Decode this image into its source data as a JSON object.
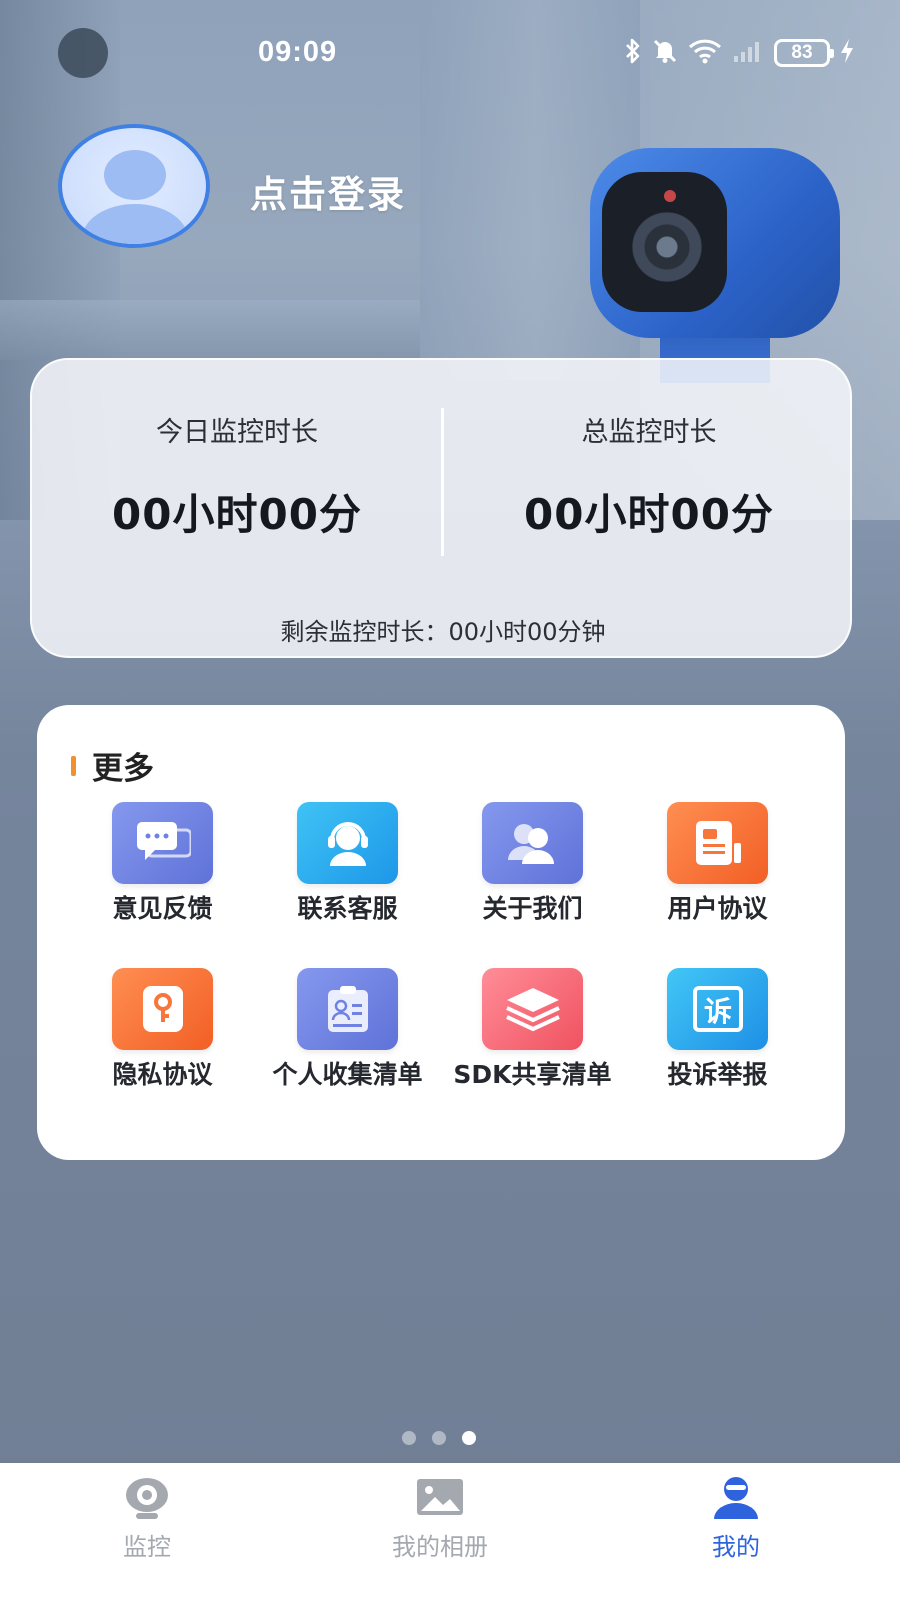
{
  "status_bar": {
    "time": "09:09",
    "battery": "83",
    "icons": [
      "bluetooth-icon",
      "mute-icon",
      "wifi-icon",
      "signal-icon",
      "battery-icon",
      "charging-icon"
    ]
  },
  "profile": {
    "login_text": "点击登录"
  },
  "stats": {
    "today_label": "今日监控时长",
    "today_value": "00小时00分",
    "total_label": "总监控时长",
    "total_value": "00小时00分",
    "remaining": "剩余监控时长：00小时00分钟"
  },
  "more": {
    "title": "更多",
    "items": [
      {
        "label": "意见反馈",
        "icon": "feedback-icon",
        "color": "#6f82e4"
      },
      {
        "label": "联系客服",
        "icon": "customer-service-icon",
        "color": "#2aa9ef"
      },
      {
        "label": "关于我们",
        "icon": "about-us-icon",
        "color": "#6f82e4"
      },
      {
        "label": "用户协议",
        "icon": "user-agreement-icon",
        "color": "#f7763c"
      },
      {
        "label": "隐私协议",
        "icon": "privacy-icon",
        "color": "#f7763c"
      },
      {
        "label": "个人收集清单",
        "icon": "personal-info-list-icon",
        "color": "#6f82e4"
      },
      {
        "label": "SDK共享清单",
        "icon": "sdk-list-icon",
        "color": "#f66f7c"
      },
      {
        "label": "投诉举报",
        "icon": "complaint-icon",
        "color": "#2aa9ef"
      }
    ]
  },
  "pager": {
    "count": 3,
    "active": 3
  },
  "bottom_nav": {
    "items": [
      {
        "label": "监控",
        "icon": "monitor-icon"
      },
      {
        "label": "我的相册",
        "icon": "album-icon"
      },
      {
        "label": "我的",
        "icon": "profile-icon"
      }
    ],
    "active_index": 2,
    "active_color": "#2f63de",
    "inactive_color": "#a4a9b0"
  }
}
